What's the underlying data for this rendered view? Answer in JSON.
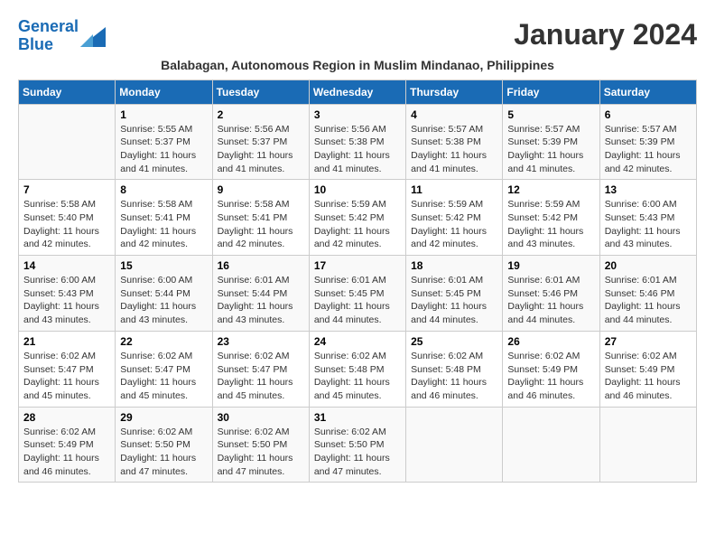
{
  "logo": {
    "line1": "General",
    "line2": "Blue"
  },
  "title": "January 2024",
  "subtitle": "Balabagan, Autonomous Region in Muslim Mindanao, Philippines",
  "days_of_week": [
    "Sunday",
    "Monday",
    "Tuesday",
    "Wednesday",
    "Thursday",
    "Friday",
    "Saturday"
  ],
  "weeks": [
    [
      {
        "day": "",
        "info": ""
      },
      {
        "day": "1",
        "info": "Sunrise: 5:55 AM\nSunset: 5:37 PM\nDaylight: 11 hours\nand 41 minutes."
      },
      {
        "day": "2",
        "info": "Sunrise: 5:56 AM\nSunset: 5:37 PM\nDaylight: 11 hours\nand 41 minutes."
      },
      {
        "day": "3",
        "info": "Sunrise: 5:56 AM\nSunset: 5:38 PM\nDaylight: 11 hours\nand 41 minutes."
      },
      {
        "day": "4",
        "info": "Sunrise: 5:57 AM\nSunset: 5:38 PM\nDaylight: 11 hours\nand 41 minutes."
      },
      {
        "day": "5",
        "info": "Sunrise: 5:57 AM\nSunset: 5:39 PM\nDaylight: 11 hours\nand 41 minutes."
      },
      {
        "day": "6",
        "info": "Sunrise: 5:57 AM\nSunset: 5:39 PM\nDaylight: 11 hours\nand 42 minutes."
      }
    ],
    [
      {
        "day": "7",
        "info": "Sunrise: 5:58 AM\nSunset: 5:40 PM\nDaylight: 11 hours\nand 42 minutes."
      },
      {
        "day": "8",
        "info": "Sunrise: 5:58 AM\nSunset: 5:41 PM\nDaylight: 11 hours\nand 42 minutes."
      },
      {
        "day": "9",
        "info": "Sunrise: 5:58 AM\nSunset: 5:41 PM\nDaylight: 11 hours\nand 42 minutes."
      },
      {
        "day": "10",
        "info": "Sunrise: 5:59 AM\nSunset: 5:42 PM\nDaylight: 11 hours\nand 42 minutes."
      },
      {
        "day": "11",
        "info": "Sunrise: 5:59 AM\nSunset: 5:42 PM\nDaylight: 11 hours\nand 42 minutes."
      },
      {
        "day": "12",
        "info": "Sunrise: 5:59 AM\nSunset: 5:42 PM\nDaylight: 11 hours\nand 43 minutes."
      },
      {
        "day": "13",
        "info": "Sunrise: 6:00 AM\nSunset: 5:43 PM\nDaylight: 11 hours\nand 43 minutes."
      }
    ],
    [
      {
        "day": "14",
        "info": "Sunrise: 6:00 AM\nSunset: 5:43 PM\nDaylight: 11 hours\nand 43 minutes."
      },
      {
        "day": "15",
        "info": "Sunrise: 6:00 AM\nSunset: 5:44 PM\nDaylight: 11 hours\nand 43 minutes."
      },
      {
        "day": "16",
        "info": "Sunrise: 6:01 AM\nSunset: 5:44 PM\nDaylight: 11 hours\nand 43 minutes."
      },
      {
        "day": "17",
        "info": "Sunrise: 6:01 AM\nSunset: 5:45 PM\nDaylight: 11 hours\nand 44 minutes."
      },
      {
        "day": "18",
        "info": "Sunrise: 6:01 AM\nSunset: 5:45 PM\nDaylight: 11 hours\nand 44 minutes."
      },
      {
        "day": "19",
        "info": "Sunrise: 6:01 AM\nSunset: 5:46 PM\nDaylight: 11 hours\nand 44 minutes."
      },
      {
        "day": "20",
        "info": "Sunrise: 6:01 AM\nSunset: 5:46 PM\nDaylight: 11 hours\nand 44 minutes."
      }
    ],
    [
      {
        "day": "21",
        "info": "Sunrise: 6:02 AM\nSunset: 5:47 PM\nDaylight: 11 hours\nand 45 minutes."
      },
      {
        "day": "22",
        "info": "Sunrise: 6:02 AM\nSunset: 5:47 PM\nDaylight: 11 hours\nand 45 minutes."
      },
      {
        "day": "23",
        "info": "Sunrise: 6:02 AM\nSunset: 5:47 PM\nDaylight: 11 hours\nand 45 minutes."
      },
      {
        "day": "24",
        "info": "Sunrise: 6:02 AM\nSunset: 5:48 PM\nDaylight: 11 hours\nand 45 minutes."
      },
      {
        "day": "25",
        "info": "Sunrise: 6:02 AM\nSunset: 5:48 PM\nDaylight: 11 hours\nand 46 minutes."
      },
      {
        "day": "26",
        "info": "Sunrise: 6:02 AM\nSunset: 5:49 PM\nDaylight: 11 hours\nand 46 minutes."
      },
      {
        "day": "27",
        "info": "Sunrise: 6:02 AM\nSunset: 5:49 PM\nDaylight: 11 hours\nand 46 minutes."
      }
    ],
    [
      {
        "day": "28",
        "info": "Sunrise: 6:02 AM\nSunset: 5:49 PM\nDaylight: 11 hours\nand 46 minutes."
      },
      {
        "day": "29",
        "info": "Sunrise: 6:02 AM\nSunset: 5:50 PM\nDaylight: 11 hours\nand 47 minutes."
      },
      {
        "day": "30",
        "info": "Sunrise: 6:02 AM\nSunset: 5:50 PM\nDaylight: 11 hours\nand 47 minutes."
      },
      {
        "day": "31",
        "info": "Sunrise: 6:02 AM\nSunset: 5:50 PM\nDaylight: 11 hours\nand 47 minutes."
      },
      {
        "day": "",
        "info": ""
      },
      {
        "day": "",
        "info": ""
      },
      {
        "day": "",
        "info": ""
      }
    ]
  ]
}
